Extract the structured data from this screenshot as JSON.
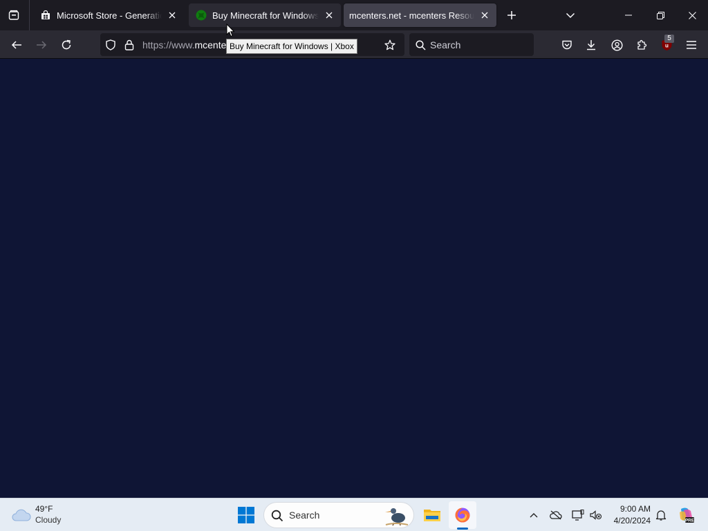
{
  "tabs": [
    {
      "title": "Microsoft Store - Generation Project",
      "icon": "store-icon"
    },
    {
      "title": "Buy Minecraft for Windows | Xbox",
      "icon": "xbox-icon"
    },
    {
      "title": "mcenters.net - mcenters Resources",
      "icon": "none",
      "active": true
    }
  ],
  "toolbar": {
    "url_scheme": "https://www.",
    "url_host": "mcente",
    "search_placeholder": "Search",
    "extension_badge": "5"
  },
  "tooltip": {
    "text": "Buy Minecraft for Windows | Xbox"
  },
  "colors": {
    "page_background": "#0f1535",
    "tab_strip": "#1c1b22",
    "toolbar": "#2b2a33",
    "taskbar": "#e5ecf4",
    "accent": "#0067c0"
  },
  "taskbar": {
    "weather_temp": "49°F",
    "weather_desc": "Cloudy",
    "search_placeholder": "Search",
    "time": "9:00 AM",
    "date": "4/20/2024"
  }
}
